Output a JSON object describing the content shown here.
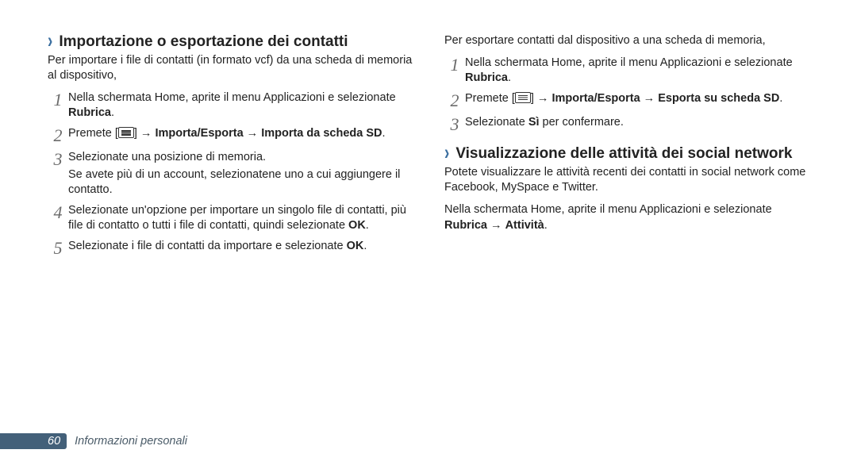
{
  "left": {
    "h_import": "Importazione o esportazione dei contatti",
    "intro_import": "Per importare i file di contatti (in formato vcf) da una scheda di memoria al dispositivo,",
    "s1a": "Nella schermata Home, aprite il menu Applicazioni e selezionate ",
    "s1b": "Rubrica",
    "s1c": ".",
    "s2a": "Premete [",
    "s2b": "] → ",
    "s2c": "Importa/Esporta",
    "s2d": " → ",
    "s2e": "Importa da scheda SD",
    "s2f": ".",
    "s3a": "Selezionate una posizione di memoria.",
    "s3b": "Se avete più di un account, selezionatene uno a cui aggiungere il contatto.",
    "s4a": "Selezionate un'opzione per importare un singolo file di contatti, più file di contatto o tutti i file di contatti, quindi selezionate ",
    "s4b": "OK",
    "s4c": ".",
    "s5a": "Selezionate i file di contatti da importare e selezionate ",
    "s5b": "OK",
    "s5c": "."
  },
  "right": {
    "intro_export": "Per esportare contatti dal dispositivo a una scheda di memoria,",
    "e1a": "Nella schermata Home, aprite il menu Applicazioni e selezionate ",
    "e1b": "Rubrica",
    "e1c": ".",
    "e2a": "Premete [",
    "e2b": "] → ",
    "e2c": "Importa/Esporta",
    "e2d": " → ",
    "e2e": "Esporta su scheda SD",
    "e2f": ".",
    "e3a": "Selezionate ",
    "e3b": "Sì",
    "e3c": " per confermare.",
    "h_social": "Visualizzazione delle attività dei social network",
    "social_p1": "Potete visualizzare le attività recenti dei contatti in social network come Facebook, MySpace e Twitter.",
    "social_p2a": "Nella schermata Home, aprite il menu Applicazioni e selezionate ",
    "social_p2b": "Rubrica",
    "social_p2c": " → ",
    "social_p2d": "Attività",
    "social_p2e": "."
  },
  "footer": {
    "page": "60",
    "section": "Informazioni personali"
  },
  "nums": {
    "n1": "1",
    "n2": "2",
    "n3": "3",
    "n4": "4",
    "n5": "5"
  }
}
